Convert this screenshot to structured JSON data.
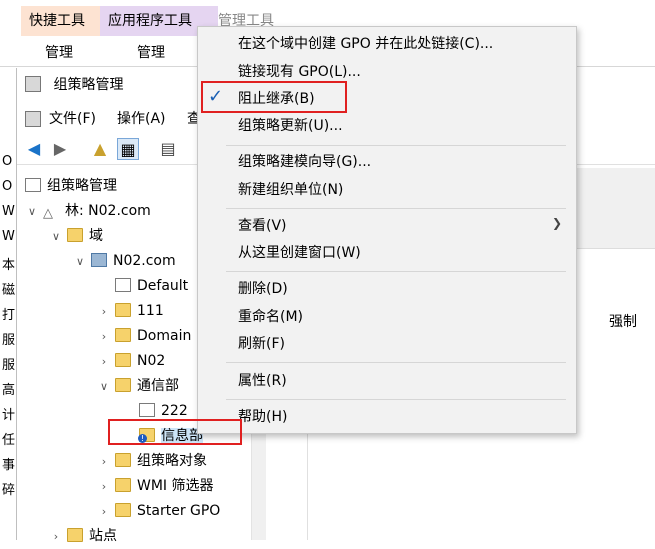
{
  "ribbon": {
    "tab_quick": "快捷工具",
    "tab_app": "应用程序工具",
    "tab_manage": "管理工具",
    "sub_quick": "管理",
    "sub_app": "管理"
  },
  "left_strip": [
    "O",
    "O",
    "W",
    "W",
    "本",
    "磁",
    "打",
    "服",
    "服",
    "高",
    "计",
    "任",
    "事",
    "碎"
  ],
  "window": {
    "title": "组策略管理",
    "menu": [
      "文件(F)",
      "操作(A)",
      "查"
    ]
  },
  "tree": {
    "root": "组策略管理",
    "forest": "林: N02.com",
    "domains": "域",
    "domain": "N02.com",
    "children": [
      "Default",
      "111",
      "Domain",
      "N02",
      "通信部"
    ],
    "ou_child": "222",
    "selected": "信息部",
    "tail": [
      "组策略对象",
      "WMI 筛选器",
      "Starter GPO",
      "站点"
    ]
  },
  "right_pane": {
    "column_force": "强制"
  },
  "context_menu": {
    "items": [
      "在这个域中创建 GPO 并在此处链接(C)...",
      "链接现有 GPO(L)...",
      "阻止继承(B)",
      "组策略更新(U)...",
      "组策略建模向导(G)...",
      "新建组织单位(N)",
      "查看(V)",
      "从这里创建窗口(W)",
      "删除(D)",
      "重命名(M)",
      "刷新(F)",
      "属性(R)",
      "帮助(H)"
    ],
    "checked_item": "阻止继承(B)"
  }
}
